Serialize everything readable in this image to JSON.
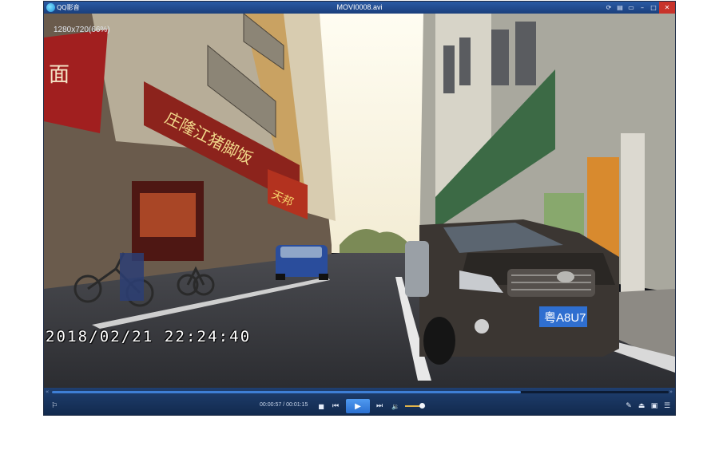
{
  "window": {
    "app_name": "QQ影音",
    "file_name": "MOVI0008.avi",
    "buttons": [
      {
        "name": "skin-icon",
        "glyph": "⟳"
      },
      {
        "name": "menu-icon",
        "glyph": "▤"
      },
      {
        "name": "mini-mode-icon",
        "glyph": "▭"
      },
      {
        "name": "minimize-icon",
        "glyph": "–"
      },
      {
        "name": "maximize-icon",
        "glyph": "□"
      },
      {
        "name": "close-icon",
        "glyph": "✕"
      }
    ]
  },
  "video": {
    "resolution_info": "1280x720(66%)",
    "overlay_timestamp": "2018/02/21 22:24:40",
    "signs": {
      "left_top_red": "面",
      "left_top_red2": "庄",
      "shop_banner": "庄隆江猪脚饭",
      "shop_banner_right": "天邦",
      "green_banner": "",
      "license_plate": "粤A8U7"
    }
  },
  "controls": {
    "seek_left_glyph": "«",
    "seek_right_glyph": "»",
    "playback_progress": 0.76,
    "time_display": "00:00:57 / 00:01:15",
    "volume_level": 0.8,
    "icons": {
      "left_tool": "sweep-icon",
      "stop": "stop-icon",
      "prev": "previous-icon",
      "play": "play-icon",
      "next": "next-icon",
      "volume": "volume-icon",
      "tools": "tools-icon",
      "eject": "eject-icon",
      "screenshot": "screenshot-icon",
      "playlist": "playlist-icon"
    },
    "glyphs": {
      "left_tool": "⚐",
      "stop": "■",
      "prev": "⏮",
      "play": "▶",
      "next": "⏭",
      "volume": "🔉",
      "tools": "✎",
      "eject": "⏏",
      "screenshot": "▣",
      "playlist": "☰"
    }
  },
  "colors": {
    "titlebar": "#1f4a8f",
    "accent": "#3e7fd6",
    "close": "#c8332b",
    "volume": "#e1b44a"
  }
}
